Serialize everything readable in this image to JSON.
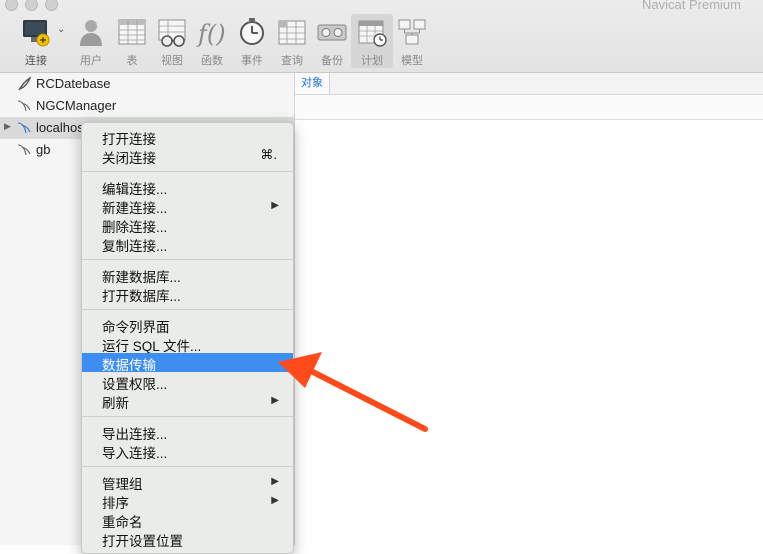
{
  "window": {
    "title": "Navicat Premium"
  },
  "toolbar": {
    "items": [
      {
        "label": "连接",
        "icon": "connection-icon"
      },
      {
        "label": "用户",
        "icon": "user-icon"
      },
      {
        "label": "表",
        "icon": "table-icon"
      },
      {
        "label": "视图",
        "icon": "view-icon"
      },
      {
        "label": "函数",
        "icon": "function-icon"
      },
      {
        "label": "事件",
        "icon": "event-icon"
      },
      {
        "label": "查询",
        "icon": "query-icon"
      },
      {
        "label": "备份",
        "icon": "backup-icon"
      },
      {
        "label": "计划",
        "icon": "schedule-icon"
      },
      {
        "label": "模型",
        "icon": "model-icon"
      }
    ],
    "function_glyph": "f()"
  },
  "sidebar": {
    "connections": [
      {
        "label": "RCDatebase",
        "icon": "feather-icon"
      },
      {
        "label": "NGCManager",
        "icon": "dolphin-icon"
      },
      {
        "label": "localhost",
        "icon": "dolphin-icon",
        "expandable": true,
        "selected": true
      },
      {
        "label": "gb",
        "icon": "dolphin-icon"
      }
    ]
  },
  "main": {
    "tabs": [
      {
        "label": "对象"
      }
    ]
  },
  "context_menu": {
    "items": [
      {
        "label": "打开连接"
      },
      {
        "label": "关闭连接",
        "shortcut": "⌘."
      },
      {
        "label": "编辑连接..."
      },
      {
        "label": "新建连接...",
        "submenu": true
      },
      {
        "label": "删除连接..."
      },
      {
        "label": "复制连接..."
      },
      {
        "label": "新建数据库..."
      },
      {
        "label": "打开数据库..."
      },
      {
        "label": "命令列界面"
      },
      {
        "label": "运行 SQL 文件..."
      },
      {
        "label": "数据传输",
        "highlighted": true
      },
      {
        "label": "设置权限..."
      },
      {
        "label": "刷新",
        "submenu": true
      },
      {
        "label": "导出连接..."
      },
      {
        "label": "导入连接..."
      },
      {
        "label": "管理组",
        "submenu": true
      },
      {
        "label": "排序",
        "submenu": true
      },
      {
        "label": "重命名"
      },
      {
        "label": "打开设置位置"
      }
    ]
  },
  "annotation": {
    "color": "#ff4a1c",
    "icon": "pointer-arrow-icon"
  },
  "colors": {
    "highlight": "#3d8ef0",
    "accent_tab": "#1e6fd6"
  }
}
